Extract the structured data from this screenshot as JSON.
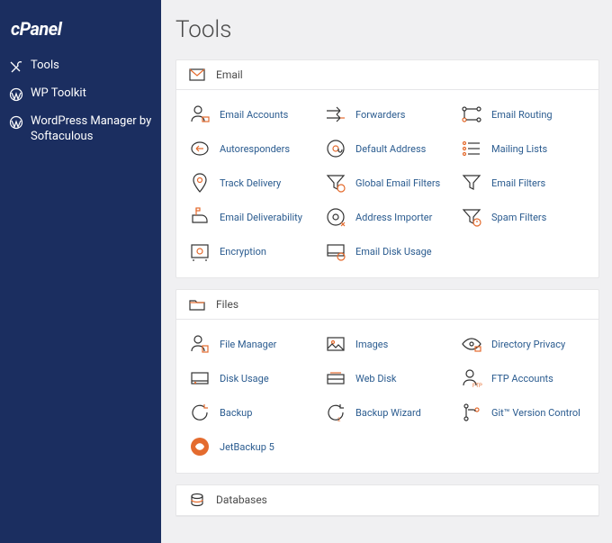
{
  "brand": "cPanel",
  "colors": {
    "sidebar_bg": "#1b2e60",
    "link": "#2a5b8f",
    "accent": "#e46b2e",
    "stroke": "#333"
  },
  "sidebar": {
    "items": [
      {
        "label": "Tools"
      },
      {
        "label": "WP Toolkit"
      },
      {
        "label": "WordPress Manager by Softaculous"
      }
    ]
  },
  "page": {
    "title": "Tools"
  },
  "sections": {
    "email": {
      "title": "Email",
      "items": [
        {
          "label": "Email Accounts"
        },
        {
          "label": "Forwarders"
        },
        {
          "label": "Email Routing"
        },
        {
          "label": "Autoresponders"
        },
        {
          "label": "Default Address"
        },
        {
          "label": "Mailing Lists"
        },
        {
          "label": "Track Delivery"
        },
        {
          "label": "Global Email Filters"
        },
        {
          "label": "Email Filters"
        },
        {
          "label": "Email Deliverability"
        },
        {
          "label": "Address Importer"
        },
        {
          "label": "Spam Filters"
        },
        {
          "label": "Encryption"
        },
        {
          "label": "Email Disk Usage"
        }
      ]
    },
    "files": {
      "title": "Files",
      "items": [
        {
          "label": "File Manager"
        },
        {
          "label": "Images"
        },
        {
          "label": "Directory Privacy"
        },
        {
          "label": "Disk Usage"
        },
        {
          "label": "Web Disk"
        },
        {
          "label": "FTP Accounts"
        },
        {
          "label": "Backup"
        },
        {
          "label": "Backup Wizard"
        },
        {
          "label": "Git™ Version Control"
        },
        {
          "label": "JetBackup 5"
        }
      ]
    },
    "databases": {
      "title": "Databases"
    }
  }
}
